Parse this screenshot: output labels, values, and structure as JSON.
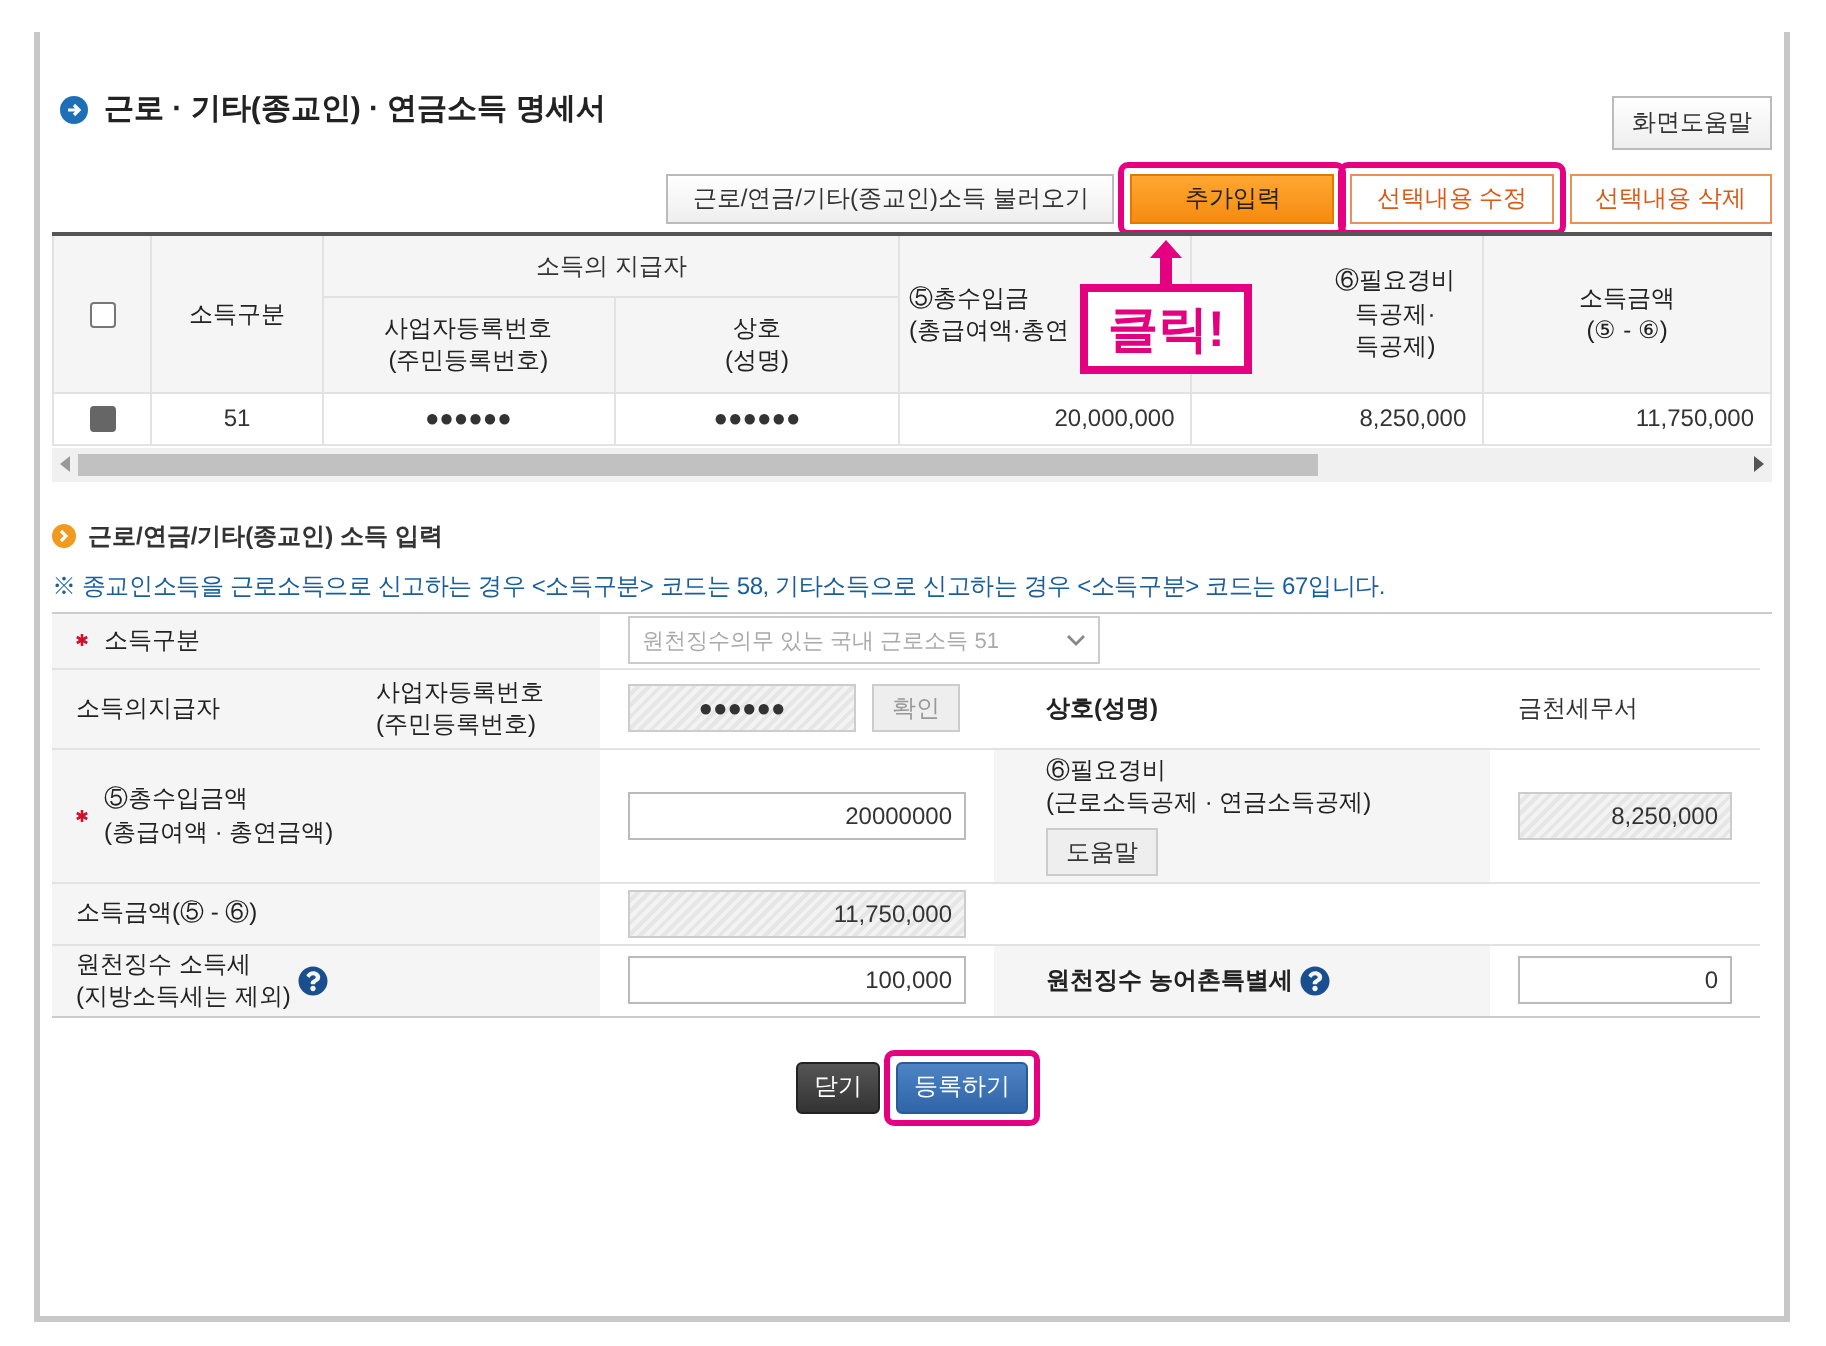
{
  "title": "근로 · 기타(종교인) · 연금소득 명세서",
  "help_button": "화면도움말",
  "toolbar": [
    {
      "label": "근로/연금/기타(종교인)소득 불러오기",
      "kind": "plain",
      "highlighted": false
    },
    {
      "label": "추가입력",
      "kind": "primary",
      "highlighted": true
    },
    {
      "label": "선택내용 수정",
      "kind": "outline",
      "highlighted": true
    },
    {
      "label": "선택내용 삭제",
      "kind": "outline",
      "highlighted": false
    }
  ],
  "callout": "클릭!",
  "table": {
    "select_all": false,
    "columns": [
      {
        "kind": "single",
        "lines": [
          "소득구분"
        ]
      },
      {
        "kind": "group",
        "label": "소득의 지급자",
        "colspan": 2,
        "children": [
          {
            "lines": [
              "사업자등록번호",
              "(주민등록번호)"
            ]
          },
          {
            "lines": [
              "상호",
              "(성명)"
            ]
          }
        ]
      },
      {
        "kind": "single",
        "lines": [
          "⑤총수입금",
          "(총급여액·총연"
        ]
      },
      {
        "kind": "single",
        "lines": [
          "⑥필요경비",
          "득공제·",
          "득공제)"
        ]
      },
      {
        "kind": "single",
        "lines": [
          "소득금액",
          "(⑤ - ⑥)"
        ]
      }
    ],
    "rows": [
      {
        "selected": true,
        "cells": [
          "51",
          "●●●●●●",
          "●●●●●●",
          "20,000,000",
          "8,250,000",
          "11,750,000"
        ]
      }
    ]
  },
  "section": {
    "title": "근로/연금/기타(종교인) 소득 입력",
    "note": "※ 종교인소득을 근로소득으로 신고하는 경우 <소득구분> 코드는 58, 기타소득으로 신고하는 경우 <소득구분> 코드는 67입니다."
  },
  "form": {
    "income_type": {
      "label": "소득구분",
      "required": true,
      "value": "원천징수의무 있는 국내 근로소득 51",
      "disabled": true
    },
    "payer": {
      "label": "소득의지급자",
      "id_label": [
        "사업자등록번호",
        "(주민등록번호)"
      ],
      "id_value": "●●●●●●",
      "confirm": "확인",
      "confirm_disabled": true,
      "name_label": "상호(성명)",
      "name_value": "금천세무서"
    },
    "total": {
      "label": [
        "⑤총수입금액",
        "(총급여액 · 총연금액)"
      ],
      "required": true,
      "value": "20000000",
      "expense_label": [
        "⑥필요경비",
        "(근로소득공제 · 연금소득공제)"
      ],
      "help": "도움말",
      "expense_value": "8,250,000"
    },
    "income": {
      "label": "소득금액(⑤ - ⑥)",
      "value": "11,750,000"
    },
    "tax": {
      "label": [
        "원천징수 소득세",
        "(지방소득세는 제외)"
      ],
      "value": "100,000",
      "rural_label": "원천징수 농어촌특별세",
      "rural_value": "0"
    }
  },
  "buttons": [
    {
      "label": "닫기",
      "kind": "dark",
      "highlighted": false
    },
    {
      "label": "등록하기",
      "kind": "blue",
      "highlighted": true
    }
  ]
}
